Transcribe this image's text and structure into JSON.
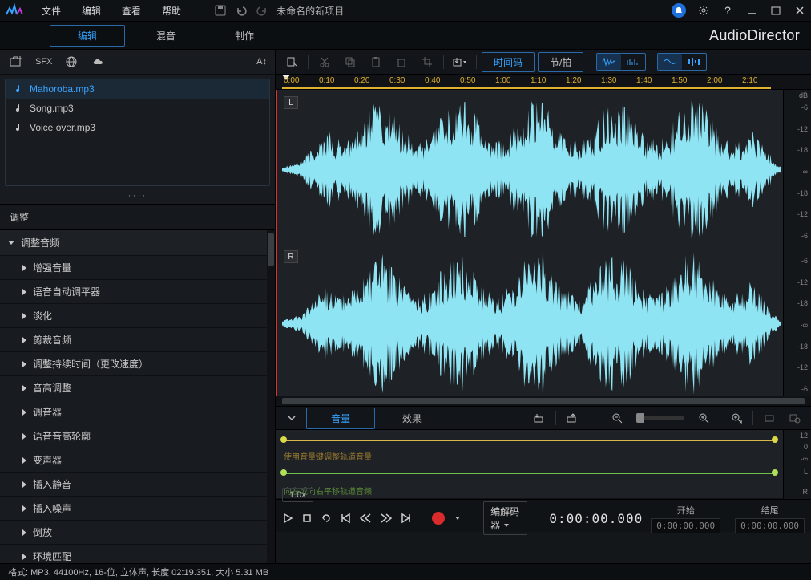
{
  "title": {
    "project": "未命名的新项目"
  },
  "menu": {
    "file": "文件",
    "edit": "编辑",
    "view": "查看",
    "help": "帮助"
  },
  "brand": "AudioDirector",
  "modes": {
    "edit": "编辑",
    "mix": "混音",
    "produce": "制作"
  },
  "library": {
    "sfx": "SFX",
    "font": "A↕",
    "files": [
      {
        "name": "Mahoroba.mp3",
        "selected": true
      },
      {
        "name": "Song.mp3",
        "selected": false
      },
      {
        "name": "Voice over.mp3",
        "selected": false
      }
    ]
  },
  "adjust": {
    "header": "调整",
    "group": "调整音频",
    "items": [
      "增强音量",
      "语音自动调平器",
      "淡化",
      "剪裁音频",
      "调整持续时间（更改速度）",
      "音高调整",
      "调音器",
      "语音音高轮廓",
      "变声器",
      "插入静音",
      "插入噪声",
      "倒放",
      "环境匹配"
    ]
  },
  "toolbar": {
    "timecode": "时间码",
    "beats": "节/拍"
  },
  "ruler": {
    "ticks": [
      "0;00",
      "0:10",
      "0:20",
      "0:30",
      "0:40",
      "0:50",
      "1:00",
      "1:10",
      "1:20",
      "1:30",
      "1:40",
      "1:50",
      "2:00",
      "2:10"
    ]
  },
  "channels": {
    "left": "L",
    "right": "R"
  },
  "db": {
    "top": "dB",
    "vals": [
      "-6",
      "-12",
      "-18",
      "-∞",
      "-18",
      "-12",
      "-6"
    ]
  },
  "lower": {
    "volume": "音量",
    "effects": "效果"
  },
  "env": {
    "vol_hint": "使用音量键调整轨道音量",
    "pan_hint": "向左或向右平移轨道音频",
    "scale1": [
      "12",
      "0",
      "-∞"
    ],
    "scale2": [
      "L",
      "",
      "R"
    ]
  },
  "transport": {
    "speed": "1.0x",
    "codec": "编解码器",
    "time": "0:00:00.000",
    "start_lbl": "开始",
    "end_lbl": "结尾",
    "start": "0:00:00.000",
    "end": "0:00:00.000"
  },
  "status": {
    "text": "格式: MP3, 44100Hz, 16-位, 立体声, 长度 02:19.351, 大小 5.31 MB"
  }
}
